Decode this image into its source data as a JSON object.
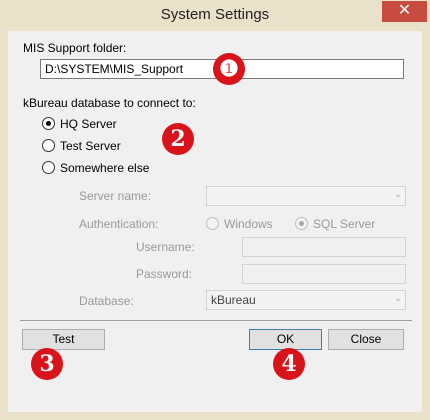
{
  "window": {
    "title": "System Settings",
    "close_glyph": "✕"
  },
  "mis": {
    "label": "MIS Support folder:",
    "value": "D:\\SYSTEM\\MIS_Support"
  },
  "db": {
    "label": "kBureau database to connect to:",
    "options": [
      {
        "label": "HQ Server",
        "selected": true
      },
      {
        "label": "Test Server",
        "selected": false
      },
      {
        "label": "Somewhere else",
        "selected": false
      }
    ]
  },
  "custom": {
    "server_name_label": "Server name:",
    "server_name_value": "",
    "auth_label": "Authentication:",
    "auth_windows": "Windows",
    "auth_sql": "SQL Server",
    "auth_selected": "SQL Server",
    "username_label": "Username:",
    "password_label": "Password:",
    "database_label": "Database:",
    "database_value": "kBureau"
  },
  "buttons": {
    "test": "Test",
    "ok": "OK",
    "close": "Close"
  },
  "callouts": [
    "❶",
    "2",
    "3",
    "4"
  ],
  "colors": {
    "frame": "#e9e1c9",
    "close_button": "#c74b3f",
    "callout": "#d8141a",
    "default_button_border": "#3c7fb1"
  }
}
